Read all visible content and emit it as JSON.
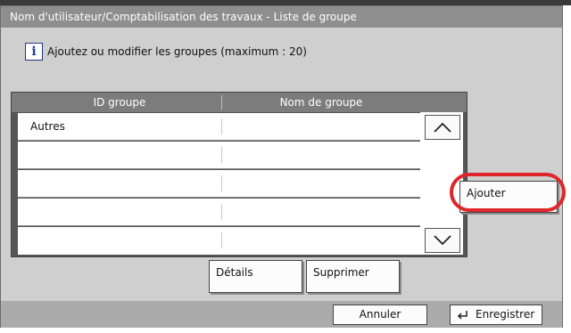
{
  "window": {
    "title": "Nom d'utilisateur/Comptabilisation des travaux - Liste de groupe"
  },
  "info": {
    "icon": "info-icon",
    "message": "Ajoutez ou modifier les groupes (maximum : 20)"
  },
  "table": {
    "headers": [
      "ID groupe",
      "Nom de groupe"
    ],
    "rows": [
      {
        "id": "Autres",
        "name": ""
      },
      {
        "id": "",
        "name": ""
      },
      {
        "id": "",
        "name": ""
      },
      {
        "id": "",
        "name": ""
      },
      {
        "id": "",
        "name": ""
      }
    ]
  },
  "scroll": {
    "up_icon": "chevron-up-icon",
    "down_icon": "chevron-down-icon"
  },
  "buttons": {
    "add": "Ajouter",
    "details": "Détails",
    "delete": "Supprimer",
    "cancel": "Annuler",
    "save": "Enregistrer",
    "save_icon": "enter-icon"
  },
  "colors": {
    "highlight": "#e0262b",
    "title_bar": "#8e8e8e",
    "panel": "#cfcfcf"
  }
}
